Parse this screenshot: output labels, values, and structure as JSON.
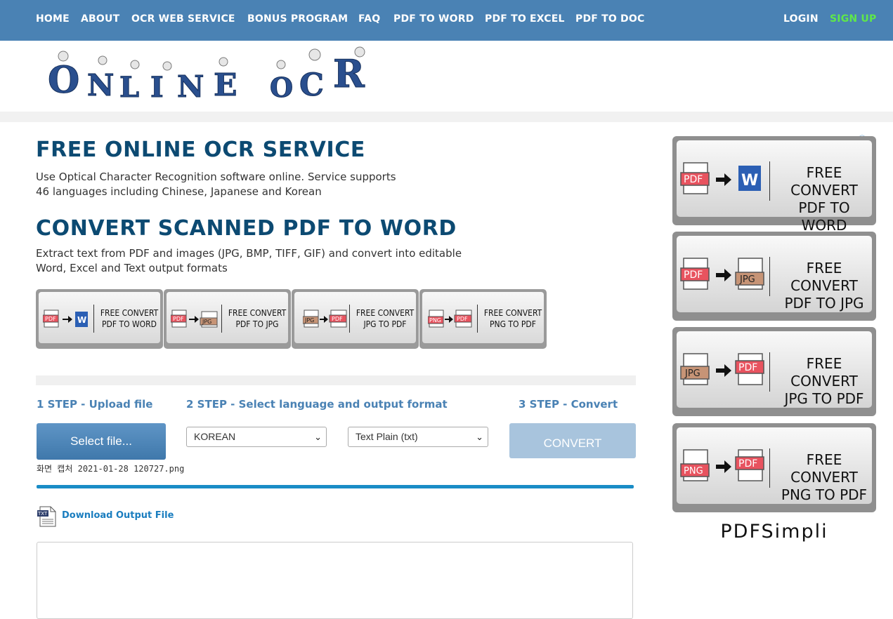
{
  "nav": {
    "items": [
      "HOME",
      "ABOUT",
      "OCR WEB SERVICE",
      "BONUS PROGRAM",
      "FAQ",
      "PDF TO WORD",
      "PDF TO EXCEL",
      "PDF TO DOC"
    ],
    "login": "LOGIN",
    "signup": "SIGN UP"
  },
  "logo": {
    "letters": [
      "O",
      "N",
      "L",
      "I",
      "N",
      "E",
      "O",
      "C",
      "R"
    ]
  },
  "main": {
    "title1": "FREE ONLINE OCR SERVICE",
    "desc1_line1": "Use Optical Character Recognition software online. Service supports",
    "desc1_line2": "46 languages including Chinese, Japanese and Korean",
    "title2": "CONVERT SCANNED PDF TO WORD",
    "desc2_line1": "Extract text from PDF and images (JPG, BMP, TIFF, GIF) and convert into editable",
    "desc2_line2": "Word, Excel and Text output formats"
  },
  "ads_small": [
    {
      "line1": "FREE CONVERT",
      "line2": "PDF TO WORD",
      "from": "PDF",
      "to": "W"
    },
    {
      "line1": "FREE CONVERT",
      "line2": "PDF TO JPG",
      "from": "PDF",
      "to": "JPG"
    },
    {
      "line1": "FREE CONVERT",
      "line2": "JPG TO PDF",
      "from": "JPG",
      "to": "PDF"
    },
    {
      "line1": "FREE CONVERT",
      "line2": "PNG TO PDF",
      "from": "PNG",
      "to": "PDF"
    }
  ],
  "ads_right": [
    {
      "line1": "FREE CONVERT",
      "line2": "PDF TO WORD",
      "from": "PDF",
      "to": "W"
    },
    {
      "line1": "FREE CONVERT",
      "line2": "PDF TO JPG",
      "from": "PDF",
      "to": "JPG"
    },
    {
      "line1": "FREE CONVERT",
      "line2": "JPG TO PDF",
      "from": "JPG",
      "to": "PDF"
    },
    {
      "line1": "FREE CONVERT",
      "line2": "PNG TO PDF",
      "from": "PNG",
      "to": "PDF"
    }
  ],
  "ad_brand": "PDFSimpli",
  "steps": {
    "step1": "1 STEP - Upload file",
    "step2": "2 STEP - Select language and output format",
    "step3": "3 STEP - Convert",
    "select_file": "Select file...",
    "language": "KOREAN",
    "format": "Text Plain (txt)",
    "convert": "CONVERT",
    "filename": "화면 캡처 2021-01-28 120727.png"
  },
  "download": {
    "icon_label": "TXT",
    "link": "Download Output File"
  },
  "colors": {
    "nav_bg": "#4a82b4",
    "title": "#0c4a72",
    "signup": "#5fe84a",
    "step": "#4a82b4",
    "progress": "#1a8cc6"
  }
}
